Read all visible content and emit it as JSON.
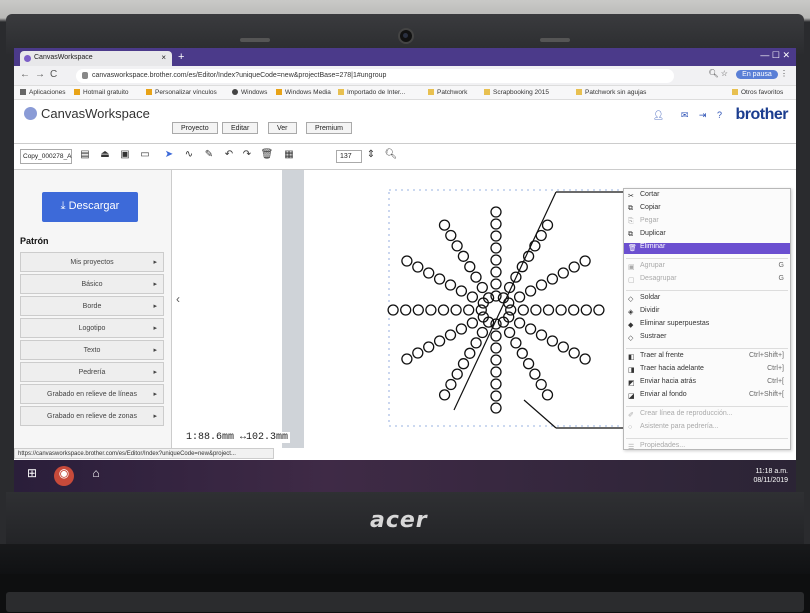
{
  "browser": {
    "tab_title": "CanvasWorkspace",
    "url": "canvasworkspace.brother.com/es/Editor/Index?uniqueCode=new&projectBase=278|1#ungroup",
    "profile_label": "En pausa",
    "bookmarks": [
      "Aplicaciones",
      "Hotmail gratuito",
      "Personalizar vínculos",
      "Windows",
      "Windows Media",
      "Importado de Inter...",
      "Patchwork",
      "Scrapbooking 2015",
      "Patchwork sin agujas",
      "Otros favoritos"
    ]
  },
  "app": {
    "logo_text": "CanvasWorkspace",
    "brand": "brother",
    "menu_tabs": [
      "Proyecto",
      "Editar",
      "Ver",
      "Premium"
    ],
    "project_name": "Copy_000278_A",
    "zoom": "137"
  },
  "left_panel": {
    "download_label": "Descargar",
    "section_title": "Patrón",
    "items": [
      "Mis proyectos",
      "Básico",
      "Borde",
      "Logotipo",
      "Texto",
      "Pedrería",
      "Grabado en relieve de líneas",
      "Grabado en relieve de zonas"
    ]
  },
  "canvas": {
    "coords_text": "1:88.6mm ↔102.3mm"
  },
  "context_menu": {
    "items": [
      {
        "label": "Cortar",
        "shortcut": "",
        "disabled": false,
        "highlighted": false
      },
      {
        "label": "Copiar",
        "shortcut": "",
        "disabled": false,
        "highlighted": false
      },
      {
        "label": "Pegar",
        "shortcut": "",
        "disabled": true,
        "highlighted": false
      },
      {
        "label": "Duplicar",
        "shortcut": "",
        "disabled": false,
        "highlighted": false
      },
      {
        "label": "Eliminar",
        "shortcut": "",
        "disabled": false,
        "highlighted": true
      },
      {
        "label": "Agrupar",
        "shortcut": "G",
        "disabled": true,
        "highlighted": false
      },
      {
        "label": "Desagrupar",
        "shortcut": "G",
        "disabled": true,
        "highlighted": false
      },
      {
        "label": "Soldar",
        "shortcut": "",
        "disabled": false,
        "highlighted": false
      },
      {
        "label": "Dividir",
        "shortcut": "",
        "disabled": false,
        "highlighted": false
      },
      {
        "label": "Eliminar superpuestas",
        "shortcut": "",
        "disabled": false,
        "highlighted": false
      },
      {
        "label": "Sustraer",
        "shortcut": "",
        "disabled": false,
        "highlighted": false
      },
      {
        "label": "Traer al frente",
        "shortcut": "Ctrl+Shift+]",
        "disabled": false,
        "highlighted": false
      },
      {
        "label": "Traer hacia adelante",
        "shortcut": "Ctrl+]",
        "disabled": false,
        "highlighted": false
      },
      {
        "label": "Enviar hacia atrás",
        "shortcut": "Ctrl+[",
        "disabled": false,
        "highlighted": false
      },
      {
        "label": "Enviar al fondo",
        "shortcut": "Ctrl+Shift+[",
        "disabled": false,
        "highlighted": false
      },
      {
        "label": "Crear línea de reproducción...",
        "shortcut": "",
        "disabled": true,
        "highlighted": false
      },
      {
        "label": "Asistente para pedrería...",
        "shortcut": "",
        "disabled": true,
        "highlighted": false
      },
      {
        "label": "Propiedades...",
        "shortcut": "",
        "disabled": true,
        "highlighted": false
      }
    ]
  },
  "status_url": "https://canvasworkspace.brother.com/es/Editor/Index?uniqueCode=new&project...",
  "taskbar": {
    "time": "11:18 a.m.",
    "date": "08/11/2019"
  },
  "laptop_brand": "acer",
  "colors": {
    "tabbar": "#4b3a8a",
    "accent": "#3d6ad9",
    "highlight": "#6b4fd0",
    "brand_blue": "#1b3d8f"
  }
}
